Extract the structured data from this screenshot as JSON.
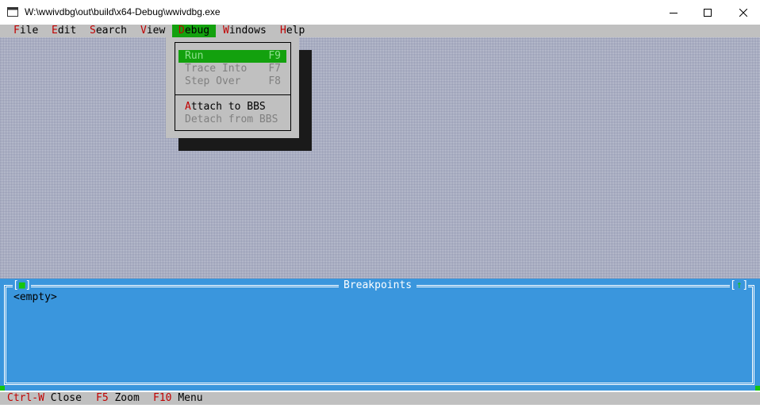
{
  "window": {
    "title": "W:\\wwivdbg\\out\\build\\x64-Debug\\wwivdbg.exe",
    "icon": "console-app-icon",
    "controls": [
      "minimize-icon",
      "maximize-icon",
      "close-icon"
    ]
  },
  "menubar": {
    "items": [
      {
        "hotkey": "F",
        "rest": "ile"
      },
      {
        "hotkey": "E",
        "rest": "dit"
      },
      {
        "hotkey": "S",
        "rest": "earch"
      },
      {
        "hotkey": "V",
        "rest": "iew"
      },
      {
        "hotkey": "D",
        "rest": "ebug"
      },
      {
        "hotkey": "W",
        "rest": "indows"
      },
      {
        "hotkey": "H",
        "rest": "elp"
      }
    ],
    "active_index": 4
  },
  "debug_menu": {
    "items": [
      {
        "label": "Run",
        "key": "F9",
        "state": "selected"
      },
      {
        "label": "Trace Into",
        "key": "F7",
        "state": "disabled"
      },
      {
        "label": "Step Over",
        "key": "F8",
        "state": "disabled"
      },
      {
        "hotkey": "A",
        "rest": "ttach to BBS",
        "key": "",
        "state": "enabled"
      },
      {
        "label": "Detach from BBS",
        "key": "",
        "state": "disabled"
      }
    ]
  },
  "breakpoints": {
    "title": "Breakpoints",
    "close_box": "[■]",
    "zoom_box": "[↑]",
    "empty_text": "<empty>"
  },
  "statusbar": {
    "items": [
      {
        "key": "Ctrl-W",
        "label": "Close"
      },
      {
        "key": "F5",
        "label": "Zoom"
      },
      {
        "key": "F10",
        "label": "Menu"
      }
    ]
  },
  "colors": {
    "menu_bg": "#c0c0c0",
    "hotkey": "#c00000",
    "highlight": "#13a10e",
    "pane_bg": "#3a96dd",
    "desktop_bg": "#c5c9d6"
  }
}
